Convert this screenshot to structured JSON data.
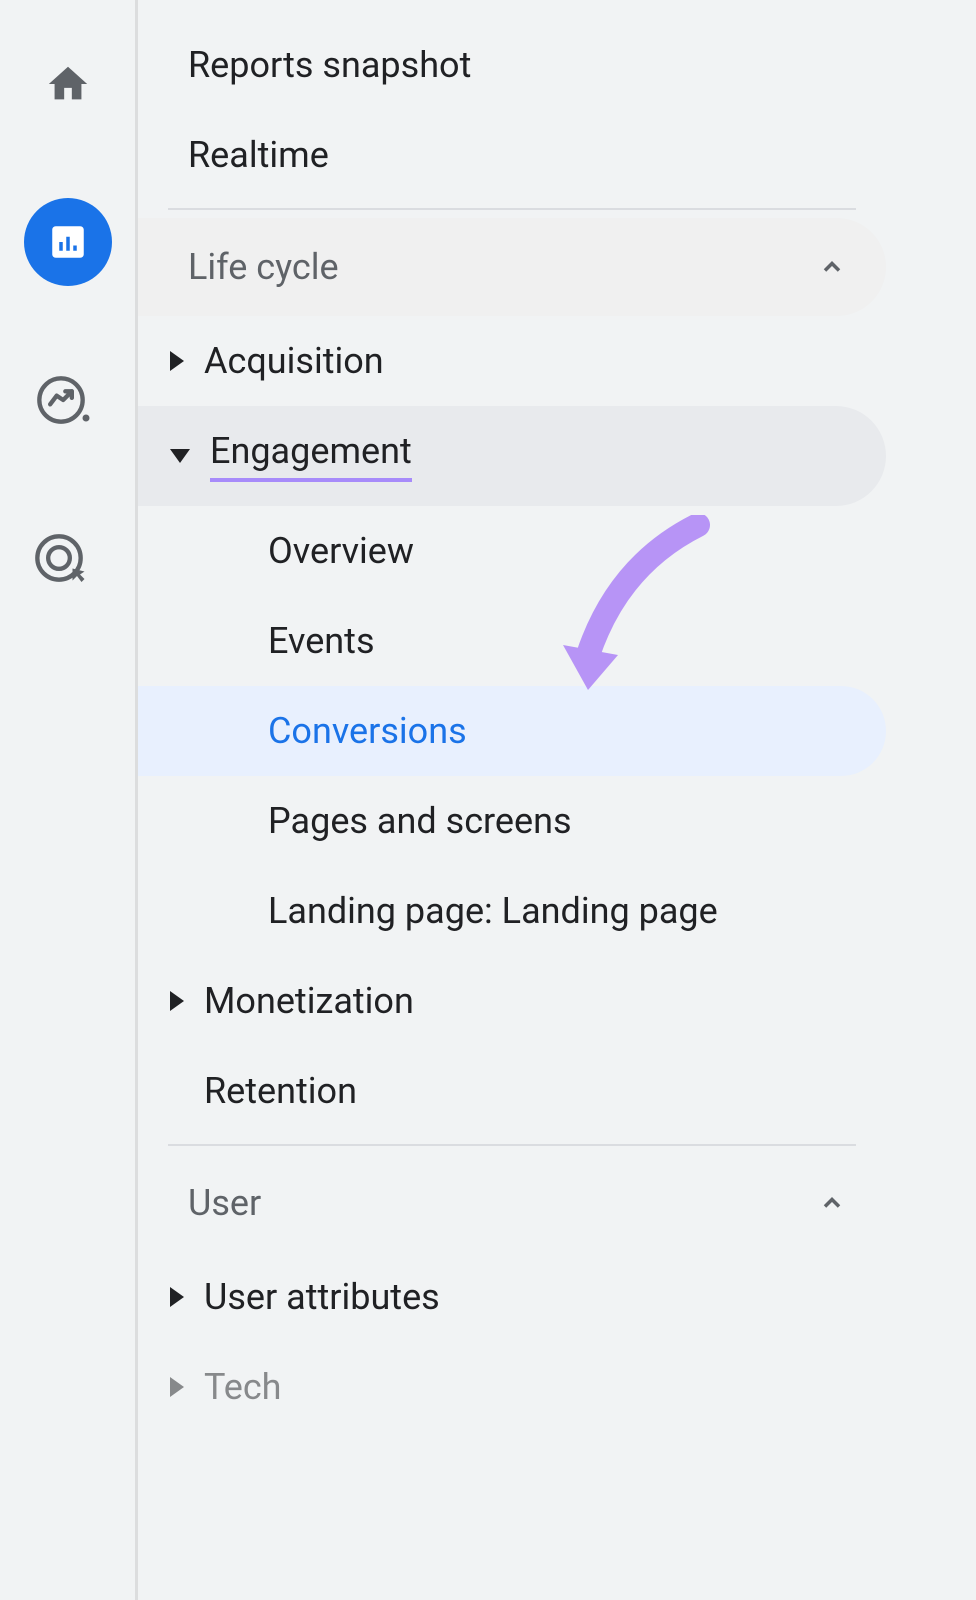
{
  "top_items": [
    {
      "label": "Reports snapshot"
    },
    {
      "label": "Realtime"
    }
  ],
  "sections": [
    {
      "title": "Life cycle",
      "expanded": true,
      "highlighted": true,
      "groups": [
        {
          "label": "Acquisition",
          "expanded": false
        },
        {
          "label": "Engagement",
          "expanded": true,
          "highlighted": true,
          "underlined": true,
          "children": [
            {
              "label": "Overview"
            },
            {
              "label": "Events"
            },
            {
              "label": "Conversions",
              "selected": true
            },
            {
              "label": "Pages and screens"
            },
            {
              "label": "Landing page: Landing page"
            }
          ]
        },
        {
          "label": "Monetization",
          "expanded": false
        },
        {
          "label": "Retention",
          "expanded": null
        }
      ]
    },
    {
      "title": "User",
      "expanded": true,
      "groups": [
        {
          "label": "User attributes",
          "expanded": false
        },
        {
          "label": "Tech",
          "expanded": false,
          "faded": true
        }
      ]
    }
  ]
}
